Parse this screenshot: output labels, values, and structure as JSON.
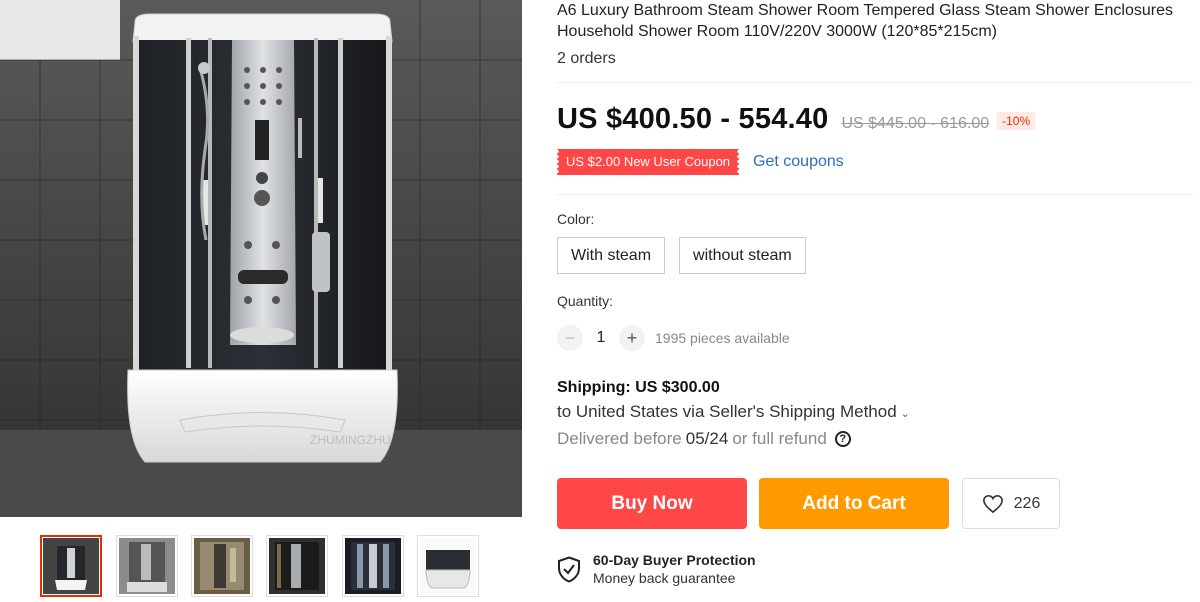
{
  "product": {
    "title": "A6 Luxury Bathroom Steam Shower Room Tempered Glass Steam Shower Enclosures Household Shower Room 110V/220V 3000W (120*85*215cm)",
    "orders": "2 orders"
  },
  "gallery": {
    "watermark": "ZHUMINGZHU",
    "thumbnail_count": 6,
    "active_index": 0
  },
  "price": {
    "current": "US $400.50 - 554.40",
    "original": "US $445.00 - 616.00",
    "discount": "-10%"
  },
  "coupon": {
    "label": "US $2.00 New User Coupon",
    "link": "Get coupons"
  },
  "color": {
    "label": "Color:",
    "options": [
      "With steam",
      "without steam"
    ]
  },
  "quantity": {
    "label": "Quantity:",
    "minus": "−",
    "value": "1",
    "plus": "+",
    "available": "1995 pieces available"
  },
  "shipping": {
    "title": "Shipping: US $300.00",
    "method": "to United States via Seller's Shipping Method",
    "delivered_prefix": "Delivered before",
    "delivered_date": "05/24",
    "delivered_suffix": "or full refund",
    "help_icon": "?"
  },
  "actions": {
    "buy_now": "Buy Now",
    "add_to_cart": "Add to Cart",
    "wishlist_count": "226"
  },
  "protection": {
    "title": "60-Day Buyer Protection",
    "subtitle": "Money back guarantee"
  },
  "colors": {
    "buy_now": "#ff4747",
    "add_to_cart": "#ff9900",
    "coupon": "#ff4747",
    "link": "#2e6fb5",
    "active_thumb_border": "#e62e04"
  },
  "icons": {
    "wishlist": "heart-icon",
    "protection": "shield-check-icon",
    "ship_dropdown": "chevron-down-icon"
  }
}
